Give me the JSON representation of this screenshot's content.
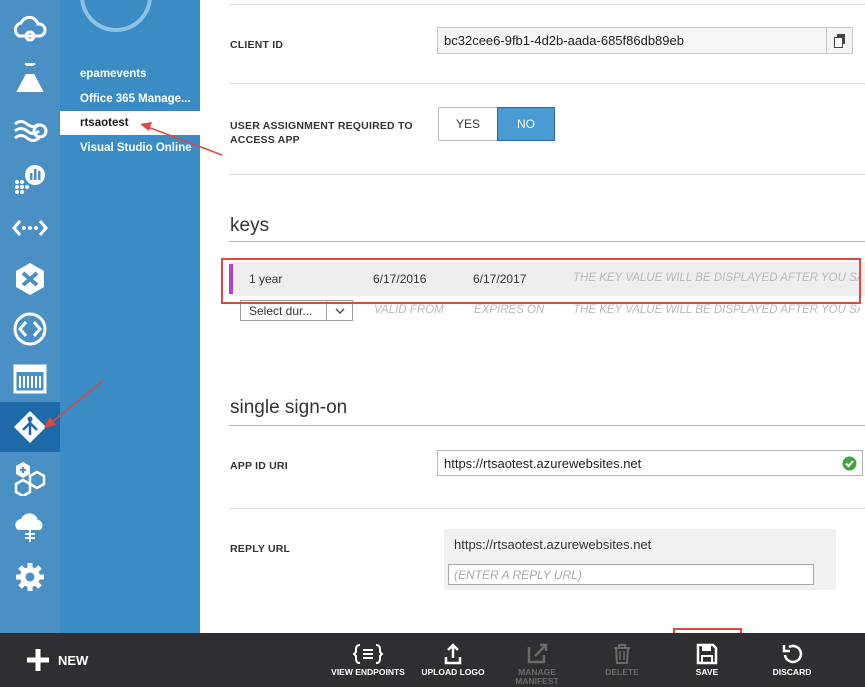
{
  "nav_sub": {
    "items": [
      {
        "label": "epamevents"
      },
      {
        "label": "Office 365 Manage..."
      },
      {
        "label": "rtsaotest"
      },
      {
        "label": "Visual Studio Online"
      }
    ]
  },
  "rail": {
    "icons": [
      "cloud-services-icon",
      "machine-learning-icon",
      "stream-analytics-icon",
      "hdinsight-icon",
      "api-management-icon",
      "visual-studio-icon",
      "remote-app-icon",
      "scheduler-icon",
      "active-directory-icon",
      "marketplace-icon",
      "cloud-upload-icon",
      "settings-icon"
    ],
    "selected": "active-directory-icon",
    "accent": "#4b90c5"
  },
  "app": {
    "client_id_label": "CLIENT ID",
    "client_id_value": "bc32cee6-9fb1-4d2b-aada-685f86db89eb",
    "user_assignment_label_1": "USER ASSIGNMENT REQUIRED TO",
    "user_assignment_label_2": "ACCESS APP",
    "toggle_yes": "YES",
    "toggle_no": "NO",
    "toggle_selected": "NO"
  },
  "keys": {
    "title": "keys",
    "row": {
      "duration": "1 year",
      "valid_from": "6/17/2016",
      "expires_on": "6/17/2017",
      "value": "THE KEY VALUE WILL BE DISPLAYED AFTER YOU SAVE I"
    },
    "new_row": {
      "select_value": "Select dur...",
      "valid_from": "VALID FROM",
      "expires_on": "EXPIRES ON",
      "value": "THE KEY VALUE WILL BE DISPLAYED AFTER YOU SAVE I"
    }
  },
  "sso": {
    "title": "single sign-on",
    "app_id_uri_label": "APP ID URI",
    "app_id_uri_value": "https://rtsaotest.azurewebsites.net",
    "reply_url_label": "REPLY URL",
    "reply_url_value": "https://rtsaotest.azurewebsites.net",
    "reply_url_placeholder": "(ENTER A REPLY URL)"
  },
  "command_bar": {
    "new_label": "NEW",
    "buttons": [
      {
        "label": "VIEW ENDPOINTS",
        "enabled": true
      },
      {
        "label": "UPLOAD LOGO",
        "enabled": true
      },
      {
        "label": "MANAGE MANIFEST",
        "enabled": false
      },
      {
        "label": "DELETE",
        "enabled": false
      },
      {
        "label": "SAVE",
        "enabled": true
      },
      {
        "label": "DISCARD",
        "enabled": true
      }
    ]
  },
  "colors": {
    "sub_nav": "#3b8cc4",
    "toggle_selected": "#4a9ad6",
    "key_marker": "#b045c9",
    "annotation": "#e2463c",
    "command_bar": "#2f2f33",
    "valid_check": "#3fa73f"
  }
}
